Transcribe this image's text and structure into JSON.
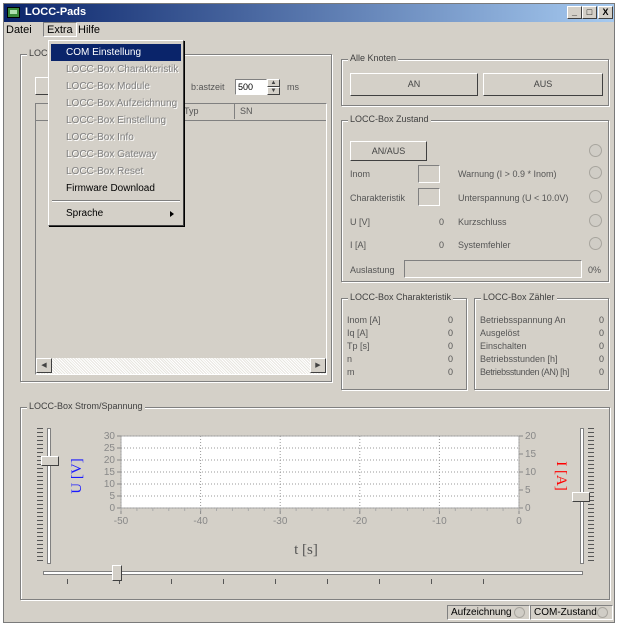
{
  "window": {
    "title": "LOCC-Pads",
    "minimize": "_",
    "maximize": "□",
    "close": "X"
  },
  "menu": {
    "datei": "Datei",
    "extra": "Extra",
    "hilfe": "Hilfe"
  },
  "extra_menu": {
    "items": [
      {
        "label": "COM Einstellung",
        "state": "selected"
      },
      {
        "label": "LOCC-Box Charakteristik",
        "state": "disabled"
      },
      {
        "label": "LOCC-Box Module",
        "state": "disabled"
      },
      {
        "label": "LOCC-Box Aufzeichnung",
        "state": "disabled"
      },
      {
        "label": "LOCC-Box Einstellung",
        "state": "disabled"
      },
      {
        "label": "LOCC-Box Info",
        "state": "disabled"
      },
      {
        "label": "LOCC-Box Gateway",
        "state": "disabled"
      },
      {
        "label": "LOCC-Box Reset",
        "state": "disabled"
      },
      {
        "label": "Firmware Download",
        "state": "enabled"
      },
      {
        "label": "Sprache",
        "state": "enabled"
      }
    ]
  },
  "left_panel": {
    "group_title": "LOC",
    "abtastzeit_label": "b:astzeit",
    "abtastzeit_value": "500",
    "abtastzeit_unit": "ms",
    "columns": [
      "Typ",
      "SN"
    ]
  },
  "alle_knoten": {
    "title": "Alle Knoten",
    "an": "AN",
    "aus": "AUS"
  },
  "zustand": {
    "title": "LOCC-Box Zustand",
    "anaus": "AN/AUS",
    "rows": [
      {
        "label": "Inom",
        "value": ""
      },
      {
        "label": "Charakteristik",
        "value": ""
      },
      {
        "label": "U [V]",
        "value": "0"
      },
      {
        "label": "I [A]",
        "value": "0"
      }
    ],
    "warnings": [
      "Warnung (I > 0.9 * Inom)",
      "Unterspannung (U < 10.0V)",
      "Kurzschluss",
      "Systemfehler"
    ],
    "auslastung_label": "Auslastung",
    "auslastung_pct": "0%",
    "auslastung_value": 0
  },
  "charakteristik": {
    "title": "LOCC-Box Charakteristik",
    "rows": [
      {
        "label": "Inom [A]",
        "value": "0"
      },
      {
        "label": "Iq [A]",
        "value": "0"
      },
      {
        "label": "Tp [s]",
        "value": "0"
      },
      {
        "label": "n",
        "value": "0"
      },
      {
        "label": "m",
        "value": "0"
      }
    ]
  },
  "zaehler": {
    "title": "LOCC-Box Zähler",
    "rows": [
      {
        "label": "Betriebsspannung An",
        "value": "0"
      },
      {
        "label": "Ausgelöst",
        "value": "0"
      },
      {
        "label": "Einschalten",
        "value": "0"
      },
      {
        "label": "Betriebsstunden [h]",
        "value": "0"
      },
      {
        "label": "Betriebsstunden (AN) [h]",
        "value": "0"
      }
    ]
  },
  "strom": {
    "title": "LOCC-Box Strom/Spannung"
  },
  "chart_data": {
    "type": "line",
    "title": "",
    "xlabel": "t [s]",
    "ylabel": "U [V]",
    "y2label": "I [A]",
    "xlim": [
      -50,
      0
    ],
    "ylim": [
      0,
      30
    ],
    "y2lim": [
      0,
      20
    ],
    "x_ticks": [
      "-50",
      "-40",
      "-30",
      "-20",
      "-10",
      "0"
    ],
    "y_ticks": [
      "30",
      "25",
      "20",
      "15",
      "10",
      "5",
      "0"
    ],
    "y2_ticks": [
      "20",
      "15",
      "10",
      "5",
      "0"
    ],
    "grid": true,
    "colors": {
      "voltage": "#1a1aff",
      "current": "#ff0000"
    },
    "series": []
  },
  "statusbar": {
    "aufzeichnung": "Aufzeichnung",
    "com": "COM-Zustand"
  }
}
